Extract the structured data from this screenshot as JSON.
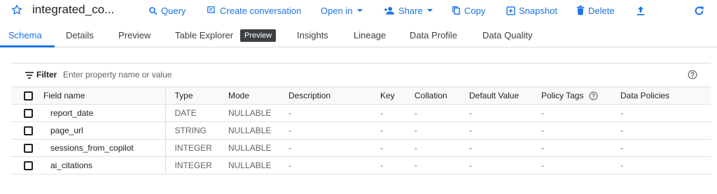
{
  "toolbar": {
    "title": "integrated_co...",
    "query": "Query",
    "create_conversation": "Create conversation",
    "open_in": "Open in",
    "share": "Share",
    "copy": "Copy",
    "snapshot": "Snapshot",
    "delete": "Delete"
  },
  "tabs": {
    "schema": "Schema",
    "details": "Details",
    "preview": "Preview",
    "table_explorer": "Table Explorer",
    "table_explorer_badge": "Preview",
    "insights": "Insights",
    "lineage": "Lineage",
    "data_profile": "Data Profile",
    "data_quality": "Data Quality"
  },
  "filter": {
    "label": "Filter",
    "placeholder": "Enter property name or value"
  },
  "table": {
    "headers": {
      "field_name": "Field name",
      "type": "Type",
      "mode": "Mode",
      "description": "Description",
      "key": "Key",
      "collation": "Collation",
      "default_value": "Default Value",
      "policy_tags": "Policy Tags",
      "data_policies": "Data Policies"
    },
    "rows": [
      {
        "field_name": "report_date",
        "type": "DATE",
        "mode": "NULLABLE",
        "description": "-",
        "key": "-",
        "collation": "-",
        "default_value": "-",
        "policy_tags": "-",
        "data_policies": "-"
      },
      {
        "field_name": "page_url",
        "type": "STRING",
        "mode": "NULLABLE",
        "description": "-",
        "key": "-",
        "collation": "-",
        "default_value": "-",
        "policy_tags": "-",
        "data_policies": "-"
      },
      {
        "field_name": "sessions_from_copilot",
        "type": "INTEGER",
        "mode": "NULLABLE",
        "description": "-",
        "key": "-",
        "collation": "-",
        "default_value": "-",
        "policy_tags": "-",
        "data_policies": "-"
      },
      {
        "field_name": "ai_citations",
        "type": "INTEGER",
        "mode": "NULLABLE",
        "description": "-",
        "key": "-",
        "collation": "-",
        "default_value": "-",
        "policy_tags": "-",
        "data_policies": "-"
      }
    ]
  },
  "colors": {
    "accent": "#1a73e8",
    "badge_bg": "#3c4043",
    "header_bg": "#f8f9fa",
    "border": "#dadce0"
  },
  "icons": {
    "star": "star-icon",
    "query": "search-icon",
    "create_conversation": "chat-icon",
    "share": "person-add-icon",
    "copy": "copy-icon",
    "snapshot": "snapshot-icon",
    "delete": "trash-icon",
    "upload": "upload-icon",
    "refresh": "refresh-icon",
    "filter": "filter-icon",
    "help": "help-icon"
  }
}
